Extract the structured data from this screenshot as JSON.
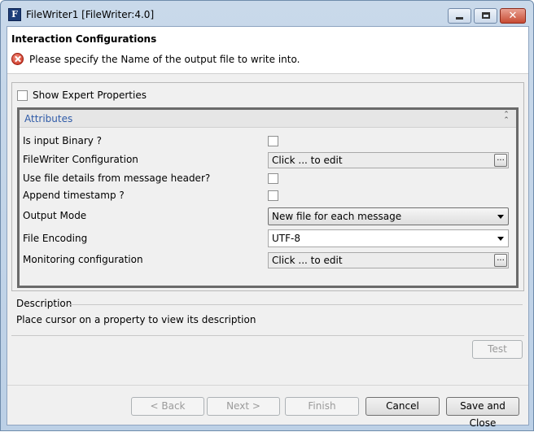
{
  "window": {
    "title": "FileWriter1 [FileWriter:4.0]",
    "icon_letter": "F",
    "close_glyph": "✕"
  },
  "header": {
    "title": "Interaction Configurations",
    "message": "Please specify the Name of the output file to write into."
  },
  "expert": {
    "label": "Show Expert Properties",
    "checked": false
  },
  "attributes": {
    "title": "Attributes",
    "collapse_glyph": "⌃",
    "rows": [
      {
        "label": "Is input Binary ?",
        "type": "checkbox",
        "checked": false
      },
      {
        "label": "FileWriter Configuration",
        "type": "edit",
        "value": "Click ... to edit",
        "button": "..."
      },
      {
        "label": "Use file details from message header?",
        "type": "checkbox",
        "checked": false
      },
      {
        "label": "Append timestamp ?",
        "type": "checkbox",
        "checked": false
      },
      {
        "label": "Output Mode",
        "type": "combo",
        "value": "New file for each message"
      },
      {
        "label": "File Encoding",
        "type": "combo",
        "value": "UTF-8"
      },
      {
        "label": "Monitoring configuration",
        "type": "edit",
        "value": "Click ... to edit",
        "button": "..."
      }
    ]
  },
  "description": {
    "title": "Description",
    "text": "Place cursor on a property to view its description"
  },
  "buttons": {
    "test": "Test",
    "back": "< Back",
    "next": "Next >",
    "finish": "Finish",
    "cancel": "Cancel",
    "save_close": "Save and Close"
  }
}
